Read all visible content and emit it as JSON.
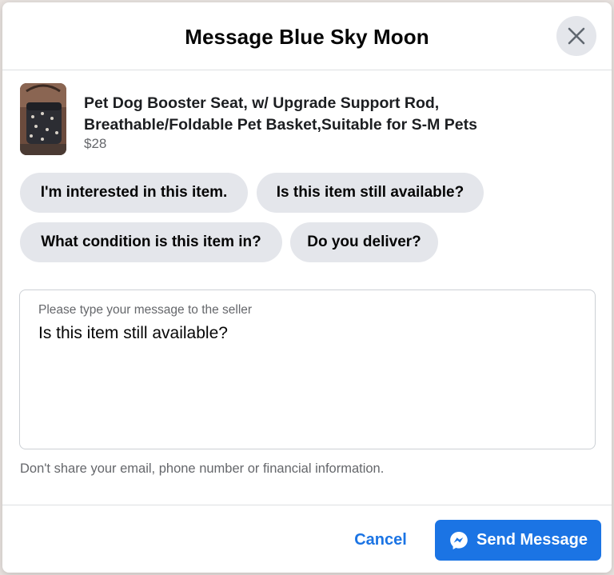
{
  "dialog": {
    "title": "Message Blue Sky Moon",
    "close_icon": "close-icon"
  },
  "listing": {
    "title_line1": "Pet Dog Booster Seat, w/ Upgrade Support Rod,",
    "title_line2": "Breathable/Foldable Pet Basket,Suitable for S-M Pets",
    "price": "$28"
  },
  "quick_replies": [
    "I'm interested in this item.",
    "Is this item still available?",
    "What condition is this item in?",
    "Do you deliver?"
  ],
  "message": {
    "label": "Please type your message to the seller",
    "value": "Is this item still available?"
  },
  "disclaimer": "Don't share your email, phone number or financial information.",
  "footer": {
    "cancel_label": "Cancel",
    "send_label": "Send Message",
    "send_icon": "messenger-icon"
  },
  "colors": {
    "accent": "#1b74e4",
    "chip_bg": "#e4e6eb",
    "secondary_text": "#65676b"
  }
}
